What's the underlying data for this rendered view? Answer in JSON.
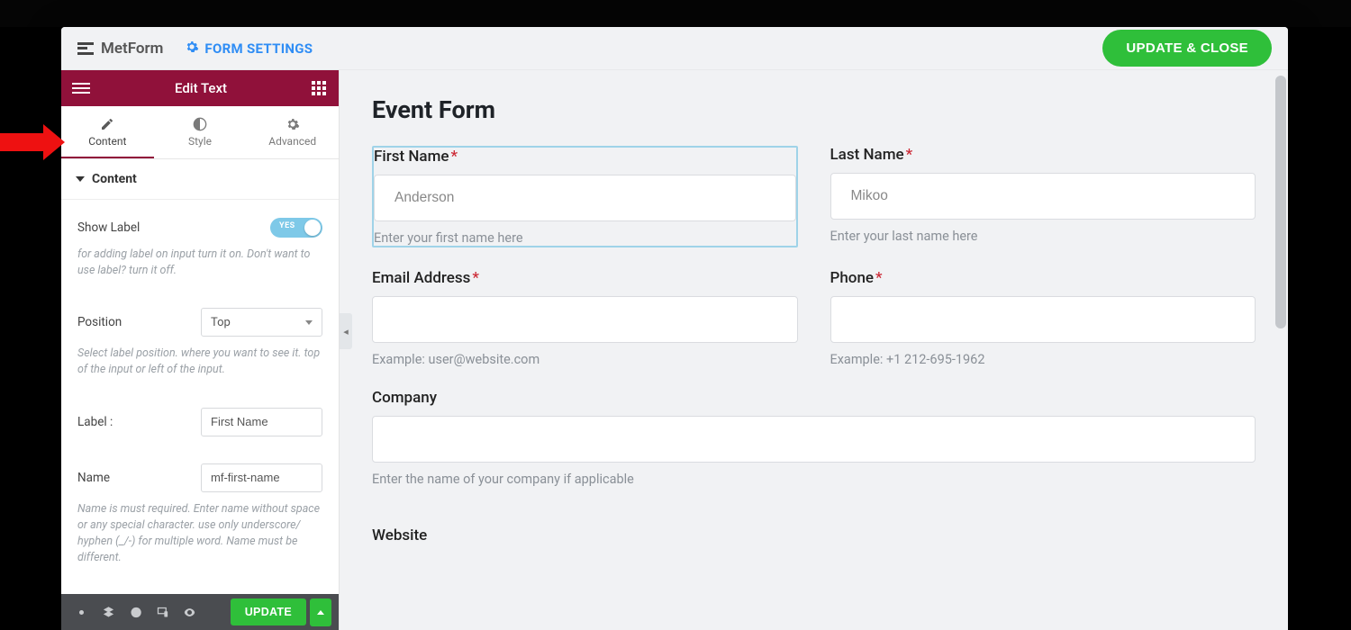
{
  "topbar": {
    "brand": "MetForm",
    "form_settings": "FORM SETTINGS",
    "update_close": "UPDATE & CLOSE"
  },
  "panel": {
    "title": "Edit Text",
    "tabs": {
      "content": "Content",
      "style": "Style",
      "advanced": "Advanced"
    },
    "section": "Content",
    "show_label": {
      "label": "Show Label",
      "value": "YES",
      "hint": "for adding label on input turn it on. Don't want to use label? turn it off."
    },
    "position": {
      "label": "Position",
      "value": "Top",
      "hint": "Select label position. where you want to see it. top of the input or left of the input."
    },
    "label_field": {
      "label": "Label :",
      "value": "First Name"
    },
    "name_field": {
      "label": "Name",
      "value": "mf-first-name",
      "hint": "Name is must required. Enter name without space or any special character. use only underscore/ hyphen (_/-) for multiple word. Name must be different."
    }
  },
  "footer": {
    "update": "UPDATE"
  },
  "form": {
    "title": "Event Form",
    "first_name": {
      "label": "First Name",
      "placeholder": "Anderson",
      "hint": "Enter your first name here"
    },
    "last_name": {
      "label": "Last Name",
      "placeholder": "Mikoo",
      "hint": "Enter your last name here"
    },
    "email": {
      "label": "Email Address",
      "hint": "Example: user@website.com"
    },
    "phone": {
      "label": "Phone",
      "hint": "Example: +1 212-695-1962"
    },
    "company": {
      "label": "Company",
      "hint": "Enter the name of your company if applicable"
    },
    "website": {
      "label": "Website"
    }
  }
}
